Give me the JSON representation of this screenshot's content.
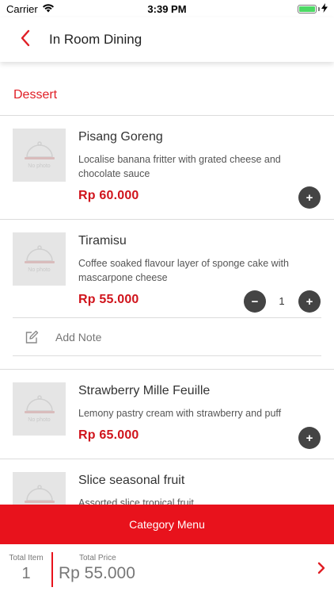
{
  "status_bar": {
    "carrier": "Carrier",
    "time": "3:39 PM"
  },
  "header": {
    "title": "In Room Dining"
  },
  "category": {
    "title": "Dessert"
  },
  "thumb_placeholder": "No photo",
  "items": [
    {
      "name": "Pisang Goreng",
      "description": "Localise banana fritter with grated cheese and chocolate sauce",
      "price": "Rp 60.000",
      "add_label": "+"
    },
    {
      "name": "Tiramisu",
      "description": "Coffee soaked flavour layer of sponge cake with mascarpone cheese",
      "price": "Rp 55.000",
      "minus_label": "−",
      "quantity": "1",
      "plus_label": "+",
      "note_placeholder": "Add Note"
    },
    {
      "name": "Strawberry Mille Feuille",
      "description": "Lemony pastry cream with strawberry and puff",
      "price": "Rp 65.000",
      "add_label": "+"
    },
    {
      "name": "Slice seasonal fruit",
      "description": "Assorted slice tropical fruit"
    }
  ],
  "category_menu": {
    "label": "Category Menu"
  },
  "footer": {
    "total_item_label": "Total Item",
    "total_item_value": "1",
    "total_price_label": "Total Price",
    "total_price_value": "Rp 55.000"
  },
  "colors": {
    "accent": "#e8121c",
    "price": "#d0141c",
    "button": "#444444",
    "battery": "#4cd964"
  }
}
